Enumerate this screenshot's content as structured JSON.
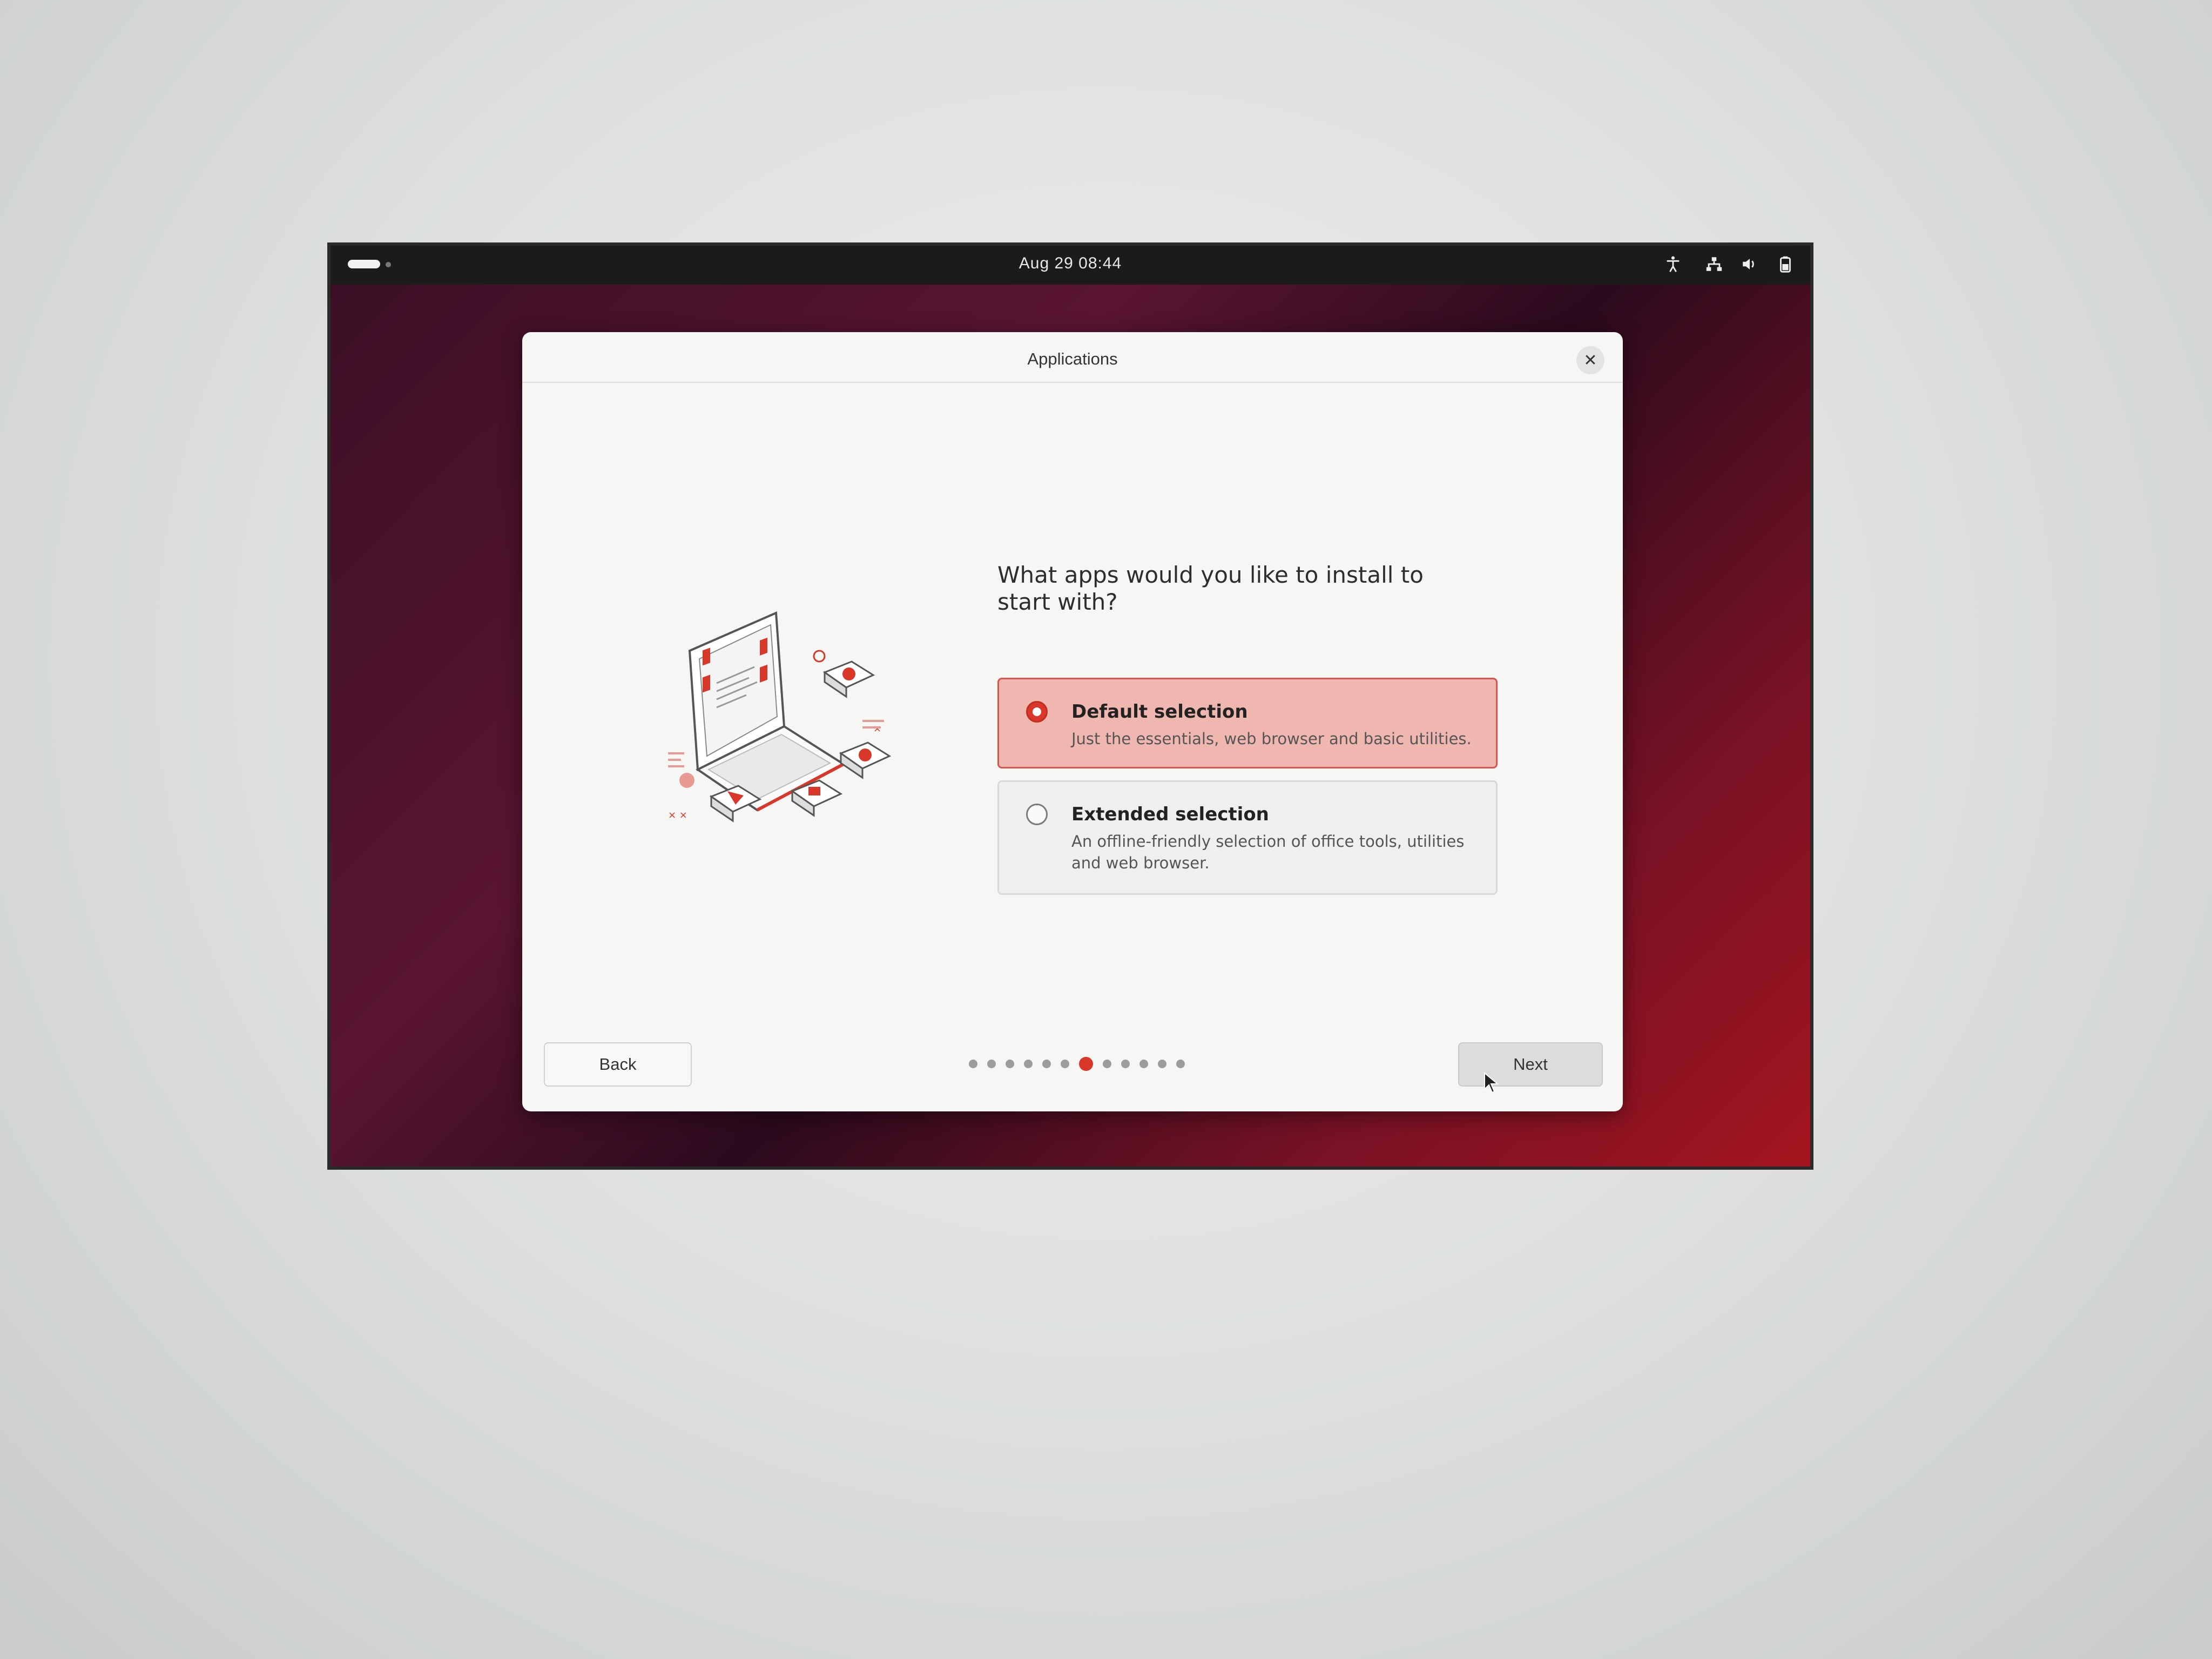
{
  "topbar": {
    "clock": "Aug 29  08:44",
    "tray_icons": [
      "accessibility-icon",
      "network-icon",
      "volume-icon",
      "battery-icon"
    ]
  },
  "dialog": {
    "title": "Applications",
    "question": "What apps would you like to install to start with?",
    "options": [
      {
        "title": "Default selection",
        "description": "Just the essentials, web browser and basic utilities.",
        "selected": true
      },
      {
        "title": "Extended selection",
        "description": "An offline-friendly selection of office tools, utilities and web browser.",
        "selected": false
      }
    ],
    "back_label": "Back",
    "next_label": "Next",
    "progress": {
      "total_steps": 12,
      "current_step": 7
    }
  },
  "colors": {
    "accent": "#d8372a",
    "selected_fill": "#f0b7b0",
    "topbar": "#1b1b1b"
  }
}
